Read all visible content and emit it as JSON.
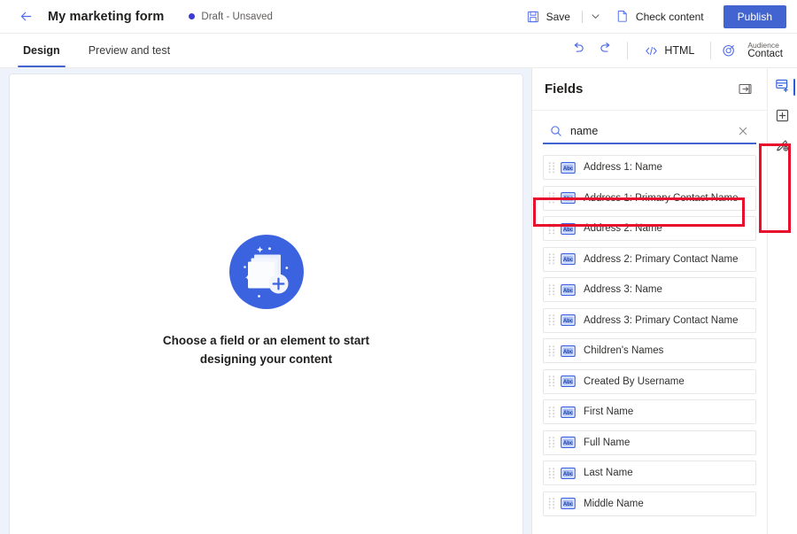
{
  "topbar": {
    "back_icon": "arrow-left-icon",
    "title": "My marketing form",
    "status": "Draft - Unsaved",
    "status_color": "#3b3bd4",
    "save_label": "Save",
    "save_icon": "save-disk-icon",
    "save_chevron_icon": "chevron-down-icon",
    "check_content_label": "Check content",
    "check_content_icon": "document-check-icon",
    "publish_label": "Publish",
    "publish_color": "#4264d0"
  },
  "tabbar": {
    "tabs": [
      {
        "label": "Design",
        "active": true
      },
      {
        "label": "Preview and test",
        "active": false
      }
    ],
    "undo_icon": "undo-arrow-icon",
    "redo_icon": "redo-arrow-icon",
    "html_label": "HTML",
    "html_icon": "code-brackets-icon",
    "audience_icon": "target-audience-icon",
    "audience_kind": "Audience",
    "audience_value": "Contact"
  },
  "canvas": {
    "illustration_icon": "add-content-illustration",
    "empty_text": "Choose a field or an element to start designing your content"
  },
  "fields_panel": {
    "title": "Fields",
    "collapse_icon": "collapse-panel-icon",
    "search": {
      "icon": "search-icon",
      "value": "name",
      "placeholder": "Search",
      "clear_icon": "close-icon"
    },
    "items": [
      {
        "label": "Address 1: Name",
        "type_icon": "text-field-icon"
      },
      {
        "label": "Address 1: Primary Contact Name",
        "type_icon": "text-field-icon"
      },
      {
        "label": "Address 2: Name",
        "type_icon": "text-field-icon"
      },
      {
        "label": "Address 2: Primary Contact Name",
        "type_icon": "text-field-icon"
      },
      {
        "label": "Address 3: Name",
        "type_icon": "text-field-icon"
      },
      {
        "label": "Address 3: Primary Contact Name",
        "type_icon": "text-field-icon"
      },
      {
        "label": "Children's Names",
        "type_icon": "text-field-icon"
      },
      {
        "label": "Created By Username",
        "type_icon": "text-field-icon"
      },
      {
        "label": "First Name",
        "type_icon": "text-field-icon"
      },
      {
        "label": "Full Name",
        "type_icon": "text-field-icon"
      },
      {
        "label": "Last Name",
        "type_icon": "text-field-icon"
      },
      {
        "label": "Middle Name",
        "type_icon": "text-field-icon"
      }
    ]
  },
  "icon_rail": {
    "buttons": [
      {
        "icon": "fields-panel-icon",
        "active": true
      },
      {
        "icon": "elements-add-icon",
        "active": false
      },
      {
        "icon": "styles-brush-icon",
        "active": false
      }
    ],
    "active_color": "#2b5bd7"
  },
  "annotations": {
    "color": "#e8112d",
    "boxes": [
      {
        "name": "search-box-highlight"
      },
      {
        "name": "icon-rail-highlight"
      }
    ]
  }
}
